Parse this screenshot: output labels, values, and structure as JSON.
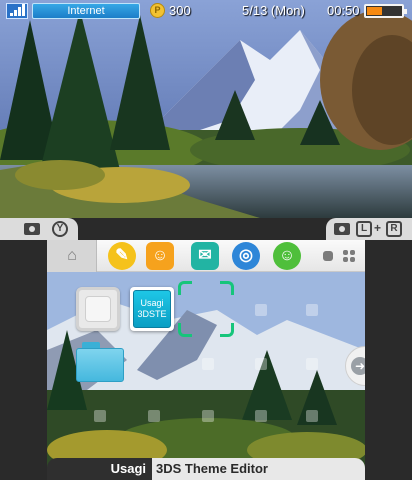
{
  "top_status": {
    "connection_label": "Internet",
    "coin_icon": "play-coin-icon",
    "coin_count": "300",
    "date": "5/13 (Mon)",
    "time": "00:50",
    "battery_level": 0.45,
    "battery_color": "#f78a12"
  },
  "camera_bar": {
    "left_button_glyph": "Y",
    "right_combo_glyphs": [
      "L",
      "+",
      "R"
    ]
  },
  "toolbar": {
    "buttons": [
      {
        "name": "home-settings-icon",
        "glyph": "⌂",
        "color": "#ffffff"
      },
      {
        "name": "pencil-icon",
        "glyph": "✎",
        "color": "#f5c21b"
      },
      {
        "name": "smiley-icon",
        "glyph": "☺",
        "color": "#f6a21d"
      },
      {
        "name": "chat-bubble-icon",
        "glyph": "✉",
        "color": "#22b4a3"
      },
      {
        "name": "globe-icon",
        "glyph": "◎",
        "color": "#2e86d8"
      },
      {
        "name": "friends-icon",
        "glyph": "☺",
        "color": "#4fbf3b"
      }
    ],
    "view_toggle_icon": "grid-view-icon"
  },
  "home_grid": {
    "usagi_tile_line1": "Usagi",
    "usagi_tile_line2": "3DSTE"
  },
  "title_bar": {
    "left_label": "Usagi",
    "right_label": "3DS Theme Editor"
  },
  "colors": {
    "accent_green": "#16c57b",
    "toolbar_bg": "#f2f2f2"
  }
}
